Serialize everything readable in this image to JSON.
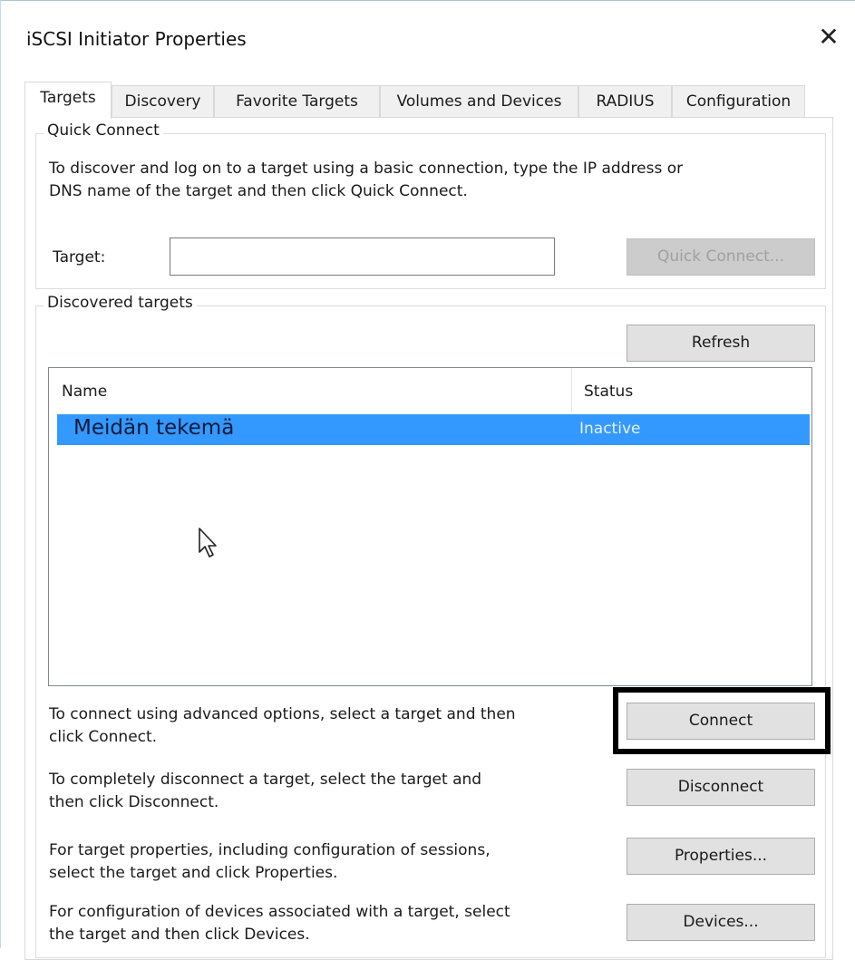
{
  "window": {
    "title": "iSCSI Initiator Properties",
    "close_glyph": "✕"
  },
  "tabs": [
    {
      "label": "Targets",
      "active": true
    },
    {
      "label": "Discovery",
      "active": false
    },
    {
      "label": "Favorite Targets",
      "active": false
    },
    {
      "label": "Volumes and Devices",
      "active": false
    },
    {
      "label": "RADIUS",
      "active": false
    },
    {
      "label": "Configuration",
      "active": false
    }
  ],
  "quick_connect": {
    "group_label": "Quick Connect",
    "description_line1": "To discover and log on to a target using a basic connection, type the IP address or",
    "description_line2": "DNS name of the target and then click Quick Connect.",
    "target_label": "Target:",
    "target_value": "",
    "button_label": "Quick Connect..."
  },
  "discovered_targets": {
    "group_label": "Discovered targets",
    "refresh_label": "Refresh",
    "columns": {
      "name": "Name",
      "status": "Status"
    },
    "rows": [
      {
        "name": "Meidän tekemä",
        "status": "Inactive",
        "selected": true
      }
    ]
  },
  "actions": [
    {
      "line1": "To connect using advanced options, select a target and then",
      "line2": "click Connect.",
      "button": "Connect",
      "highlighted": true
    },
    {
      "line1": "To completely disconnect a target, select the target and",
      "line2": "then click Disconnect.",
      "button": "Disconnect",
      "highlighted": false
    },
    {
      "line1": "For target properties, including configuration of sessions,",
      "line2": "select the target and click Properties.",
      "button": "Properties...",
      "highlighted": false
    },
    {
      "line1": "For configuration of devices associated with a target, select",
      "line2": "the target and then click Devices.",
      "button": "Devices...",
      "highlighted": false
    }
  ],
  "colors": {
    "selection": "#3399ff",
    "button_face": "#e1e1e1",
    "highlight_border": "#000000"
  },
  "icons": {
    "close": "close-icon",
    "cursor": "mouse-pointer-icon"
  }
}
